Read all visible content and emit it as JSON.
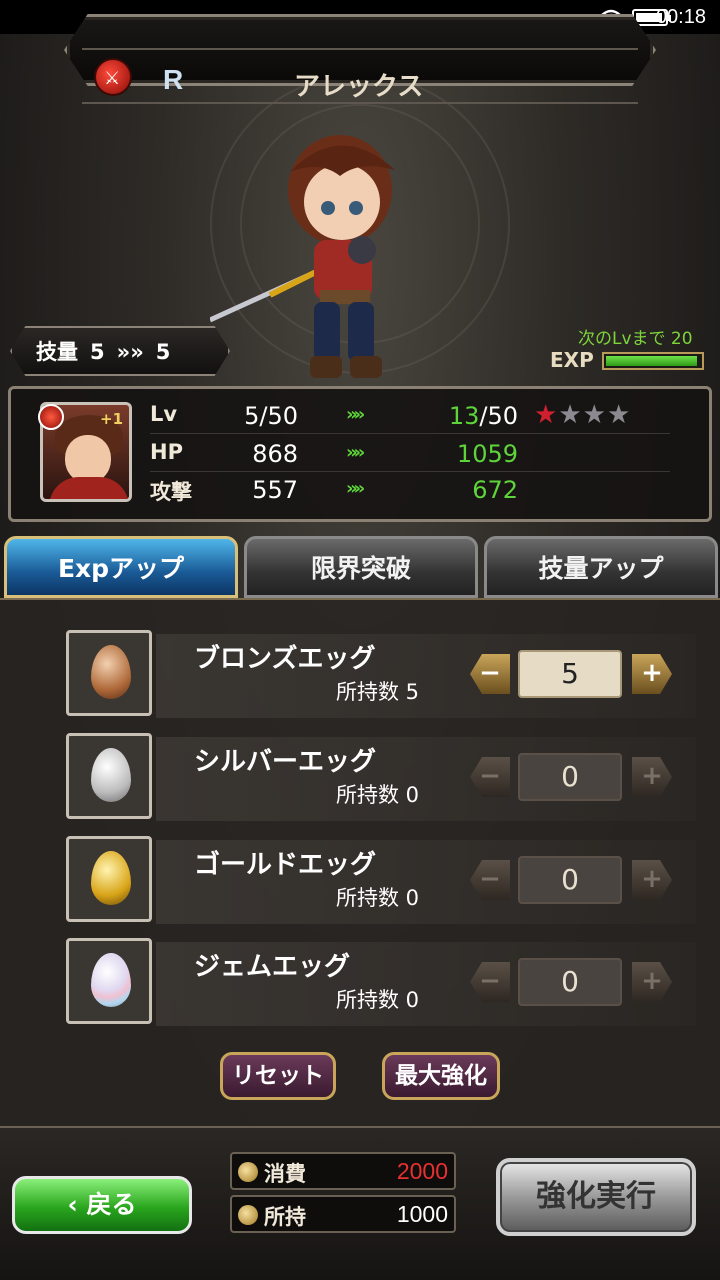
{
  "status_bar": {
    "time": "00:18"
  },
  "header": {
    "rarity": "R",
    "name": "アレックス"
  },
  "skill": {
    "label": "技量",
    "current": "5",
    "arrow": "»»",
    "next": "5"
  },
  "exp": {
    "next_label": "次のLvまで 20",
    "label": "EXP",
    "progress": 0.95
  },
  "portrait": {
    "plus": "+1"
  },
  "stats": [
    {
      "label": "Lv",
      "current": "5/50",
      "arrow": "»»",
      "next_hi": "13",
      "next_rest": "/50"
    },
    {
      "label": "HP",
      "current": "868",
      "arrow": "»»",
      "next_hi": "1059",
      "next_rest": ""
    },
    {
      "label": "攻撃",
      "current": "557",
      "arrow": "»»",
      "next_hi": "672",
      "next_rest": ""
    }
  ],
  "stars": {
    "filled": 1,
    "total": 4
  },
  "tabs": [
    {
      "label": "Expアップ",
      "active": true
    },
    {
      "label": "限界突破",
      "active": false
    },
    {
      "label": "技量アップ",
      "active": false
    }
  ],
  "items": [
    {
      "name": "ブロンズエッグ",
      "owned": "所持数 5",
      "qty": "5",
      "type": "bronze"
    },
    {
      "name": "シルバーエッグ",
      "owned": "所持数 0",
      "qty": "0",
      "type": "silver"
    },
    {
      "name": "ゴールドエッグ",
      "owned": "所持数 0",
      "qty": "0",
      "type": "gold"
    },
    {
      "name": "ジェムエッグ",
      "owned": "所持数 0",
      "qty": "0",
      "type": "gem"
    }
  ],
  "controls": {
    "minus": "−",
    "plus": "+"
  },
  "buttons": {
    "reset": "リセット",
    "max": "最大強化",
    "back": "‹ 戻る",
    "execute": "強化実行"
  },
  "cost": {
    "spend_label": "消費",
    "spend_value": "2000",
    "own_label": "所持",
    "own_value": "1000"
  },
  "colors": {
    "accent_green": "#5ed43a",
    "spend_red": "#e83030",
    "tab_active": "#1a5a96"
  }
}
